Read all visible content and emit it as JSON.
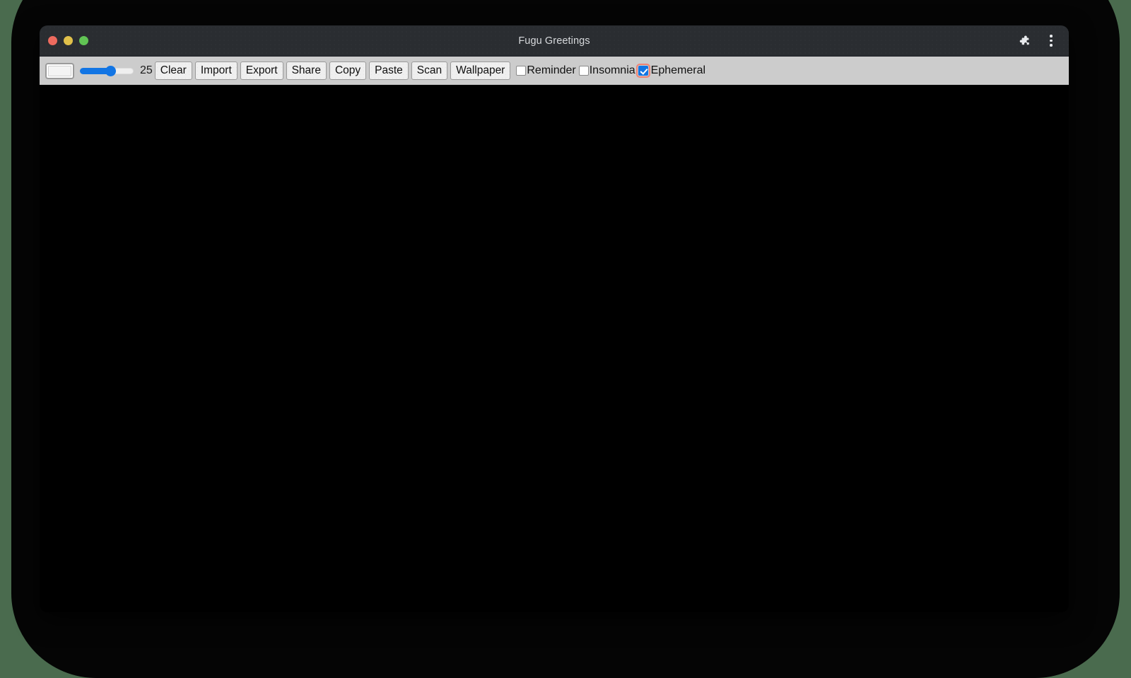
{
  "window": {
    "title": "Fugu Greetings",
    "traffic_lights": [
      {
        "name": "close",
        "color": "#ed6a5e"
      },
      {
        "name": "minimize",
        "color": "#e0c04a"
      },
      {
        "name": "zoom",
        "color": "#61c454"
      }
    ],
    "titlebar_icons": [
      {
        "name": "extensions-icon",
        "glyph": "puzzle"
      },
      {
        "name": "browser-menu-icon",
        "glyph": "kebab"
      }
    ]
  },
  "toolbar": {
    "color_picker": {
      "label": "color-picker",
      "value": "#ffffff"
    },
    "slider": {
      "label": "line-width-slider",
      "value": "25",
      "min": "0",
      "max": "50",
      "fill_percent": "50",
      "accent": "#1275e4"
    },
    "buttons": [
      {
        "name": "clear-button",
        "label": "Clear"
      },
      {
        "name": "import-button",
        "label": "Import"
      },
      {
        "name": "export-button",
        "label": "Export"
      },
      {
        "name": "share-button",
        "label": "Share"
      },
      {
        "name": "copy-button",
        "label": "Copy"
      },
      {
        "name": "paste-button",
        "label": "Paste"
      },
      {
        "name": "scan-button",
        "label": "Scan"
      },
      {
        "name": "wallpaper-button",
        "label": "Wallpaper"
      }
    ],
    "checkboxes": [
      {
        "name": "reminder-checkbox",
        "label": "Reminder",
        "checked": false,
        "focused": false
      },
      {
        "name": "insomnia-checkbox",
        "label": "Insomnia",
        "checked": false,
        "focused": false
      },
      {
        "name": "ephemeral-checkbox",
        "label": "Ephemeral",
        "checked": true,
        "focused": true
      }
    ]
  },
  "canvas": {
    "name": "drawing-canvas",
    "background": "#000000"
  },
  "colors": {
    "desktop_background": "#4a6b4e",
    "backdrop": "#050505",
    "titlebar": "#2a2d31",
    "toolbar": "#cccccc",
    "accent": "#1275e4",
    "focus_ring": "#f08273"
  }
}
